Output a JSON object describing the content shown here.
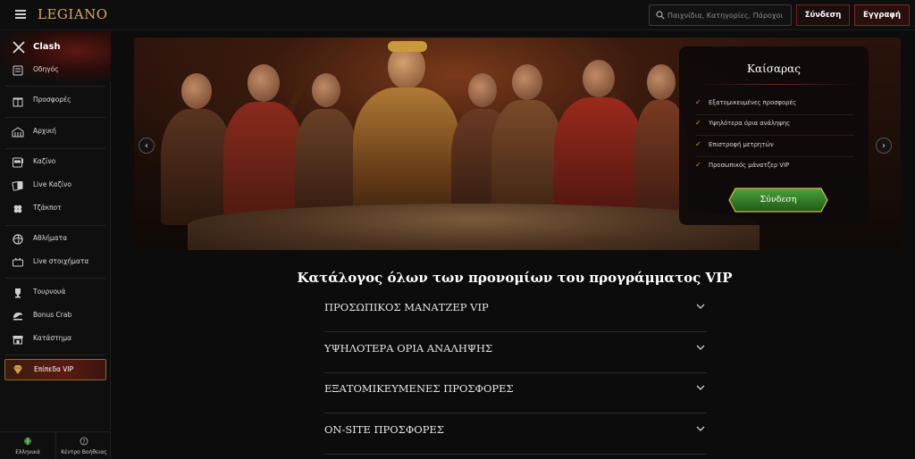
{
  "header": {
    "logo": "LEGIANO",
    "search_placeholder": "Παιχνίδια, Κατηγορίες, Πάροχοι",
    "login_label": "Σύνδεση",
    "register_label": "Εγγραφή"
  },
  "sidebar": {
    "clash_label": "Clash",
    "items": [
      {
        "label": "Οδηγός",
        "icon": "guide-icon"
      },
      {
        "label": "Προσφορές",
        "icon": "gift-icon"
      },
      {
        "label": "Αρχική",
        "icon": "home-icon"
      },
      {
        "label": "Καζίνο",
        "icon": "slot-machine-icon"
      },
      {
        "label": "Live Καζίνο",
        "icon": "cards-icon"
      },
      {
        "label": "Τζάκποτ",
        "icon": "clover-icon"
      },
      {
        "label": "Αθλήματα",
        "icon": "ball-icon"
      },
      {
        "label": "Live στοιχήματα",
        "icon": "live-icon"
      },
      {
        "label": "Τουρνουά",
        "icon": "trophy-icon"
      },
      {
        "label": "Bonus Crab",
        "icon": "crab-icon"
      },
      {
        "label": "Κατάστημα",
        "icon": "shop-icon"
      }
    ],
    "vip_label": "Επίπεδα VIP",
    "footer": {
      "language": "Ελληνικά",
      "help": "Κέντρο Βοήθειας"
    }
  },
  "hero": {
    "card_title": "Καίσαρας",
    "perks": [
      "Εξατομικευμένες προσφορές",
      "Υψηλότερα όρια ανάληψης",
      "Επιστροφή μετρητών",
      "Προσωπικός μάνατζερ VIP"
    ],
    "card_button": "Σύνδεση",
    "prev_arrow": "‹",
    "next_arrow": "›"
  },
  "main": {
    "title": "Κατάλογος όλων των προνομίων του προγράμματος VIP",
    "accordion": [
      "ΠΡΟΣΩΠΙΚΟΣ ΜΑΝΑΤΖΕΡ VIP",
      "ΥΨΗΛΟΤΕΡΑ ΟΡΙΑ ΑΝΑΛΗΨΗΣ",
      "ΕΞΑΤΟΜΙΚΕΥΜΕΝΕΣ ΠΡΟΣΦΟΡΕΣ",
      "ON-SITE ΠΡΟΣΦΟΡΕΣ"
    ]
  },
  "colors": {
    "accent_gold": "#d6a95a",
    "accent_red": "#8b2424",
    "button_green": "#2f7d1f"
  }
}
